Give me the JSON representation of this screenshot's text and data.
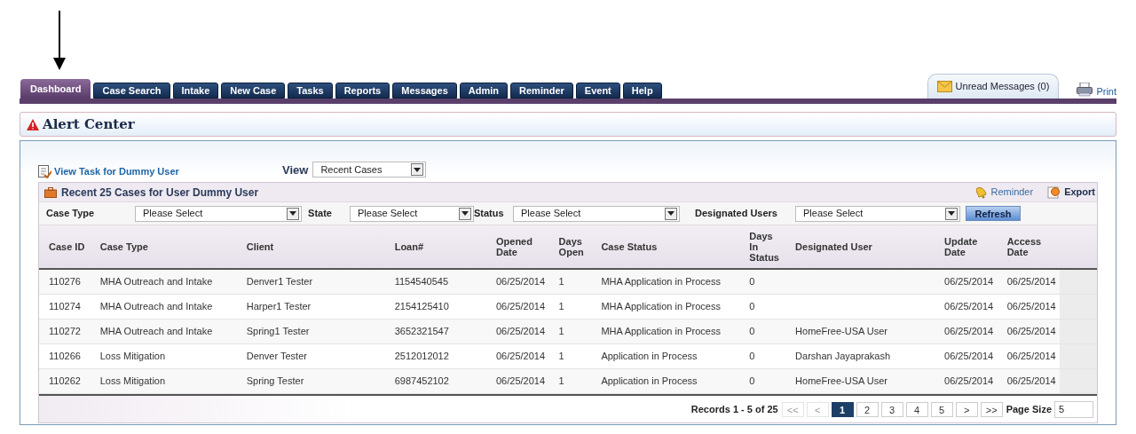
{
  "nav_tabs": [
    {
      "label": "Dashboard",
      "selected": true
    },
    {
      "label": "Case Search",
      "selected": false
    },
    {
      "label": "Intake",
      "selected": false
    },
    {
      "label": "New Case",
      "selected": false
    },
    {
      "label": "Tasks",
      "selected": false
    },
    {
      "label": "Reports",
      "selected": false
    },
    {
      "label": "Messages",
      "selected": false
    },
    {
      "label": "Admin",
      "selected": false
    },
    {
      "label": "Reminder",
      "selected": false
    },
    {
      "label": "Event",
      "selected": false
    },
    {
      "label": "Help",
      "selected": false
    }
  ],
  "unread_messages": "Unread Messages (0)",
  "print": "Print",
  "alert_center": {
    "title": "Alert Center"
  },
  "view_task_link": "View Task for Dummy User",
  "view": {
    "label": "View",
    "value": "Recent Cases"
  },
  "cases_panel": {
    "title": "Recent 25 Cases for User Dummy User",
    "reminder": "Reminder",
    "export": "Export",
    "filters": [
      {
        "label": "Case Type",
        "value": "Please Select"
      },
      {
        "label": "State",
        "value": "Please Select"
      },
      {
        "label": "Status",
        "value": "Please Select"
      },
      {
        "label": "Designated Users",
        "value": "Please Select"
      }
    ],
    "refresh": "Refresh"
  },
  "table": {
    "columns": [
      "Case ID",
      "Case Type",
      "Client",
      "Loan#",
      "Opened Date",
      "Days Open",
      "Case Status",
      "Days In Status",
      "Designated User",
      "Update Date",
      "Access Date"
    ],
    "rows": [
      [
        "110276",
        "MHA Outreach and Intake",
        "Denver1 Tester",
        "1154540545",
        "06/25/2014",
        "1",
        "MHA Application in Process",
        "0",
        "",
        "06/25/2014",
        "06/25/2014"
      ],
      [
        "110274",
        "MHA Outreach and Intake",
        "Harper1 Tester",
        "2154125410",
        "06/25/2014",
        "1",
        "MHA Application in Process",
        "0",
        "",
        "06/25/2014",
        "06/25/2014"
      ],
      [
        "110272",
        "MHA Outreach and Intake",
        "Spring1 Tester",
        "3652321547",
        "06/25/2014",
        "1",
        "MHA Application in Process",
        "0",
        "HomeFree-USA User",
        "06/25/2014",
        "06/25/2014"
      ],
      [
        "110266",
        "Loss Mitigation",
        "Denver Tester",
        "2512012012",
        "06/25/2014",
        "1",
        "Application in Process",
        "0",
        "Darshan Jayaprakash",
        "06/25/2014",
        "06/25/2014"
      ],
      [
        "110262",
        "Loss Mitigation",
        "Spring Tester",
        "6987452102",
        "06/25/2014",
        "1",
        "Application in Process",
        "0",
        "HomeFree-USA User",
        "06/25/2014",
        "06/25/2014"
      ]
    ]
  },
  "pager": {
    "records": "Records 1 - 5 of 25",
    "pages": [
      {
        "label": "<<",
        "selected": false,
        "disabled": true
      },
      {
        "label": "<",
        "selected": false,
        "disabled": true
      },
      {
        "label": "1",
        "selected": true,
        "disabled": false
      },
      {
        "label": "2",
        "selected": false,
        "disabled": false
      },
      {
        "label": "3",
        "selected": false,
        "disabled": false
      },
      {
        "label": "4",
        "selected": false,
        "disabled": false
      },
      {
        "label": "5",
        "selected": false,
        "disabled": false
      },
      {
        "label": ">",
        "selected": false,
        "disabled": false
      },
      {
        "label": ">>",
        "selected": false,
        "disabled": false
      }
    ],
    "page_size_label": "Page Size",
    "page_size": "5"
  }
}
